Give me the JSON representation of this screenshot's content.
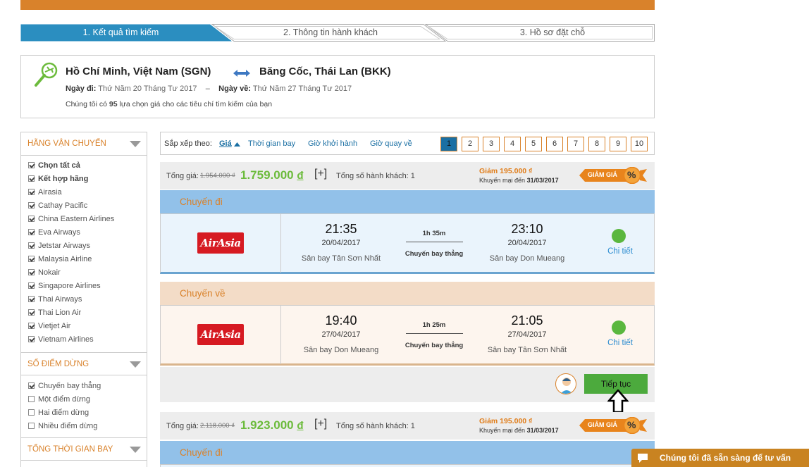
{
  "steps": [
    "1. Kết quả tìm kiếm",
    "2. Thông tin hành khách",
    "3. Hồ sơ đặt chỗ"
  ],
  "route": {
    "from": "Hồ Chí Minh, Việt Nam (SGN)",
    "to": "Băng Cốc, Thái Lan (BKK)",
    "depart_label": "Ngày đi:",
    "depart_value": "Thứ Năm 20 Tháng Tư 2017",
    "dash": "–",
    "return_label": "Ngày về:",
    "return_value": "Thứ Năm 27 Tháng Tư 2017",
    "summary_pre": "Chúng tôi có",
    "summary_count": "95",
    "summary_post": "lựa chọn giá cho các tiêu chí tìm kiếm của bạn"
  },
  "filters": {
    "airlines_title": "HÃNG VẬN CHUYỂN",
    "airlines": [
      {
        "label": "Chọn tất cả",
        "checked": true,
        "bold": true
      },
      {
        "label": "Kết hợp hãng",
        "checked": true,
        "bold": true
      },
      {
        "label": "Airasia",
        "checked": true
      },
      {
        "label": "Cathay Pacific",
        "checked": true
      },
      {
        "label": "China Eastern Airlines",
        "checked": true
      },
      {
        "label": "Eva Airways",
        "checked": true
      },
      {
        "label": "Jetstar Airways",
        "checked": true
      },
      {
        "label": "Malaysia Airline",
        "checked": true
      },
      {
        "label": "Nokair",
        "checked": true
      },
      {
        "label": "Singapore Airlines",
        "checked": true
      },
      {
        "label": "Thai Airways",
        "checked": true
      },
      {
        "label": "Thai Lion Air",
        "checked": true
      },
      {
        "label": "Vietjet Air",
        "checked": true
      },
      {
        "label": "Vietnam Airlines",
        "checked": true
      }
    ],
    "stops_title": "SỐ ĐIỂM DỪNG",
    "stops": [
      {
        "label": "Chuyến bay thẳng",
        "checked": true
      },
      {
        "label": "Một điểm dừng",
        "checked": false
      },
      {
        "label": "Hai điểm dừng",
        "checked": false
      },
      {
        "label": "Nhiều điểm dừng",
        "checked": false
      }
    ],
    "duration_title": "TỔNG THỜI GIAN BAY"
  },
  "sort": {
    "label": "Sắp xếp theo:",
    "options": [
      "Giá",
      "Thời gian bay",
      "Giờ khởi hành",
      "Giờ quay về"
    ],
    "pages": [
      "1",
      "2",
      "3",
      "4",
      "5",
      "6",
      "7",
      "8",
      "9",
      "10"
    ],
    "active_page": "1"
  },
  "results": [
    {
      "total_label": "Tổng giá:",
      "old_price": "1.954.000 ₫",
      "price": "1.759.000",
      "currency": "đ",
      "plus": "[+]",
      "pax": "Tổng số hành khách: 1",
      "discount": "Giảm 195.000 ₫",
      "promo_pre": "Khuyến mại đến",
      "promo_date": "31/03/2017",
      "badge": "GIẢM GIÁ",
      "outbound": {
        "title": "Chuyến đi",
        "airline": "AirAsia",
        "dep_time": "21:35",
        "dep_date": "20/04/2017",
        "dep_airport": "Sân bay Tân Sơn Nhất",
        "duration": "1h 35m",
        "type": "Chuyến bay thẳng",
        "arr_time": "23:10",
        "arr_date": "20/04/2017",
        "arr_airport": "Sân bay Don Mueang",
        "detail": "Chi tiết"
      },
      "inbound": {
        "title": "Chuyến về",
        "airline": "AirAsia",
        "dep_time": "19:40",
        "dep_date": "27/04/2017",
        "dep_airport": "Sân bay Don Mueang",
        "duration": "1h 25m",
        "type": "Chuyến bay thẳng",
        "arr_time": "21:05",
        "arr_date": "27/04/2017",
        "arr_airport": "Sân bay Tân Sơn Nhất",
        "detail": "Chi tiết"
      },
      "continue": "Tiếp tục"
    },
    {
      "total_label": "Tổng giá:",
      "old_price": "2.118.000 ₫",
      "price": "1.923.000",
      "currency": "đ",
      "plus": "[+]",
      "pax": "Tổng số hành khách: 1",
      "discount": "Giảm 195.000 ₫",
      "promo_pre": "Khuyến mại đến",
      "promo_date": "31/03/2017",
      "badge": "GIẢM GIÁ",
      "outbound": {
        "title": "Chuyến đi"
      }
    }
  ],
  "chat": "Chúng tôi đã sẵn sàng để tư vấn",
  "colors": {
    "accent": "#d9822b",
    "active_step": "#2b8ec0",
    "price_green": "#6cbb3c",
    "outbound_header": "#92c1e9",
    "outbound_body": "#eaf4fc",
    "inbound_header": "#f3dcc7",
    "inbound_body": "#fdf5ee"
  }
}
